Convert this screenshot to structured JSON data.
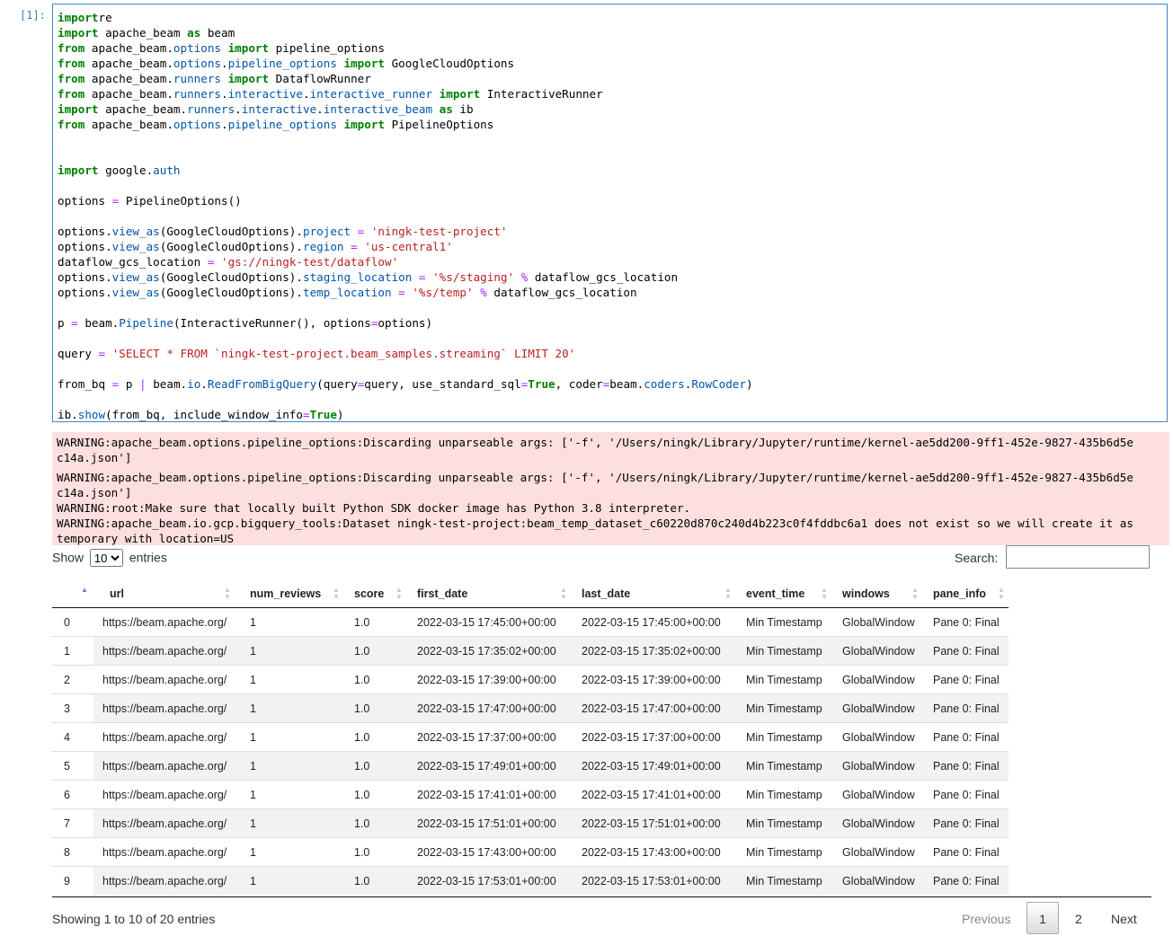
{
  "cell": {
    "prompt": "[1]:",
    "code_lines": [
      [
        [
          "kw",
          "import"
        ],
        [
          "",
          "re"
        ]
      ],
      [
        [
          "kw",
          "import"
        ],
        [
          "",
          " apache_beam "
        ],
        [
          "kw",
          "as"
        ],
        [
          "",
          " beam"
        ]
      ],
      [
        [
          "kw",
          "from"
        ],
        [
          "",
          " apache_beam."
        ],
        [
          "at",
          "options"
        ],
        [
          "",
          " "
        ],
        [
          "kw",
          "import"
        ],
        [
          "",
          " pipeline_options"
        ]
      ],
      [
        [
          "kw",
          "from"
        ],
        [
          "",
          " apache_beam."
        ],
        [
          "at",
          "options"
        ],
        [
          "",
          "."
        ],
        [
          "at",
          "pipeline_options"
        ],
        [
          "",
          " "
        ],
        [
          "kw",
          "import"
        ],
        [
          "",
          " GoogleCloudOptions"
        ]
      ],
      [
        [
          "kw",
          "from"
        ],
        [
          "",
          " apache_beam."
        ],
        [
          "at",
          "runners"
        ],
        [
          "",
          " "
        ],
        [
          "kw",
          "import"
        ],
        [
          "",
          " DataflowRunner"
        ]
      ],
      [
        [
          "kw",
          "from"
        ],
        [
          "",
          " apache_beam."
        ],
        [
          "at",
          "runners"
        ],
        [
          "",
          "."
        ],
        [
          "at",
          "interactive"
        ],
        [
          "",
          "."
        ],
        [
          "at",
          "interactive_runner"
        ],
        [
          "",
          " "
        ],
        [
          "kw",
          "import"
        ],
        [
          "",
          " InteractiveRunner"
        ]
      ],
      [
        [
          "kw",
          "import"
        ],
        [
          "",
          " apache_beam."
        ],
        [
          "at",
          "runners"
        ],
        [
          "",
          "."
        ],
        [
          "at",
          "interactive"
        ],
        [
          "",
          "."
        ],
        [
          "at",
          "interactive_beam"
        ],
        [
          "",
          " "
        ],
        [
          "kw",
          "as"
        ],
        [
          "",
          " ib"
        ]
      ],
      [
        [
          "kw",
          "from"
        ],
        [
          "",
          " apache_beam."
        ],
        [
          "at",
          "options"
        ],
        [
          "",
          "."
        ],
        [
          "at",
          "pipeline_options"
        ],
        [
          "",
          " "
        ],
        [
          "kw",
          "import"
        ],
        [
          "",
          " PipelineOptions"
        ]
      ],
      [],
      [],
      [
        [
          "kw",
          "import"
        ],
        [
          "",
          " google."
        ],
        [
          "at",
          "auth"
        ]
      ],
      [],
      [
        [
          "",
          "options "
        ],
        [
          "op",
          "="
        ],
        [
          "",
          " PipelineOptions()"
        ]
      ],
      [],
      [
        [
          "",
          "options."
        ],
        [
          "at",
          "view_as"
        ],
        [
          "",
          "(GoogleCloudOptions)."
        ],
        [
          "at",
          "project"
        ],
        [
          "",
          " "
        ],
        [
          "op",
          "="
        ],
        [
          "",
          " "
        ],
        [
          "st",
          "'ningk-test-project'"
        ]
      ],
      [
        [
          "",
          "options."
        ],
        [
          "at",
          "view_as"
        ],
        [
          "",
          "(GoogleCloudOptions)."
        ],
        [
          "at",
          "region"
        ],
        [
          "",
          " "
        ],
        [
          "op",
          "="
        ],
        [
          "",
          " "
        ],
        [
          "st",
          "'us-central1'"
        ]
      ],
      [
        [
          "",
          "dataflow_gcs_location "
        ],
        [
          "op",
          "="
        ],
        [
          "",
          " "
        ],
        [
          "st",
          "'gs://ningk-test/dataflow'"
        ]
      ],
      [
        [
          "",
          "options."
        ],
        [
          "at",
          "view_as"
        ],
        [
          "",
          "(GoogleCloudOptions)."
        ],
        [
          "at",
          "staging_location"
        ],
        [
          "",
          " "
        ],
        [
          "op",
          "="
        ],
        [
          "",
          " "
        ],
        [
          "st",
          "'%s/staging'"
        ],
        [
          "",
          " "
        ],
        [
          "op",
          "%"
        ],
        [
          "",
          " dataflow_gcs_location"
        ]
      ],
      [
        [
          "",
          "options."
        ],
        [
          "at",
          "view_as"
        ],
        [
          "",
          "(GoogleCloudOptions)."
        ],
        [
          "at",
          "temp_location"
        ],
        [
          "",
          " "
        ],
        [
          "op",
          "="
        ],
        [
          "",
          " "
        ],
        [
          "st",
          "'%s/temp'"
        ],
        [
          "",
          " "
        ],
        [
          "op",
          "%"
        ],
        [
          "",
          " dataflow_gcs_location"
        ]
      ],
      [],
      [
        [
          "",
          "p "
        ],
        [
          "op",
          "="
        ],
        [
          "",
          " beam."
        ],
        [
          "at",
          "Pipeline"
        ],
        [
          "",
          "(InteractiveRunner(), options"
        ],
        [
          "op",
          "="
        ],
        [
          "",
          "options)"
        ]
      ],
      [],
      [
        [
          "",
          "query "
        ],
        [
          "op",
          "="
        ],
        [
          "",
          " "
        ],
        [
          "st",
          "'SELECT * FROM `ningk-test-project.beam_samples.streaming` LIMIT 20'"
        ]
      ],
      [],
      [
        [
          "",
          "from_bq "
        ],
        [
          "op",
          "="
        ],
        [
          "",
          " p "
        ],
        [
          "op",
          "|"
        ],
        [
          "",
          " beam."
        ],
        [
          "at",
          "io"
        ],
        [
          "",
          "."
        ],
        [
          "at",
          "ReadFromBigQuery"
        ],
        [
          "",
          "(query"
        ],
        [
          "op",
          "="
        ],
        [
          "",
          "query, use_standard_sql"
        ],
        [
          "op",
          "="
        ],
        [
          "kw",
          "True"
        ],
        [
          "",
          ", coder"
        ],
        [
          "op",
          "="
        ],
        [
          "",
          "beam."
        ],
        [
          "at",
          "coders"
        ],
        [
          "",
          "."
        ],
        [
          "at",
          "RowCoder"
        ],
        [
          "",
          ")"
        ]
      ],
      [],
      [
        [
          "",
          "ib."
        ],
        [
          "at",
          "show"
        ],
        [
          "",
          "(from_bq, include_window_info"
        ],
        [
          "op",
          "="
        ],
        [
          "kw",
          "True"
        ],
        [
          "",
          ")"
        ]
      ]
    ]
  },
  "stderr": {
    "lines": [
      "WARNING:apache_beam.options.pipeline_options:Discarding unparseable args: ['-f', '/Users/ningk/Library/Jupyter/runtime/kernel-ae5dd200-9ff1-452e-9827-435b6d5e",
      "c14a.json']",
      "WARNING:apache_beam.options.pipeline_options:Discarding unparseable args: ['-f', '/Users/ningk/Library/Jupyter/runtime/kernel-ae5dd200-9ff1-452e-9827-435b6d5e",
      "c14a.json']",
      "WARNING:root:Make sure that locally built Python SDK docker image has Python 3.8 interpreter.",
      "WARNING:apache_beam.io.gcp.bigquery_tools:Dataset ningk-test-project:beam_temp_dataset_c60220d870c240d4b223c0f4fddbc6a1 does not exist so we will create it as",
      "temporary with location=US"
    ]
  },
  "datatable": {
    "show_label": "Show",
    "entries_label": "entries",
    "page_length": "10",
    "search_label": "Search:",
    "search_value": "",
    "columns": [
      "",
      "url",
      "num_reviews",
      "score",
      "first_date",
      "last_date",
      "event_time",
      "windows",
      "pane_info"
    ],
    "rows": [
      [
        "0",
        "https://beam.apache.org/",
        "1",
        "1.0",
        "2022-03-15 17:45:00+00:00",
        "2022-03-15 17:45:00+00:00",
        "Min Timestamp",
        "GlobalWindow",
        "Pane 0: Final"
      ],
      [
        "1",
        "https://beam.apache.org/",
        "1",
        "1.0",
        "2022-03-15 17:35:02+00:00",
        "2022-03-15 17:35:02+00:00",
        "Min Timestamp",
        "GlobalWindow",
        "Pane 0: Final"
      ],
      [
        "2",
        "https://beam.apache.org/",
        "1",
        "1.0",
        "2022-03-15 17:39:00+00:00",
        "2022-03-15 17:39:00+00:00",
        "Min Timestamp",
        "GlobalWindow",
        "Pane 0: Final"
      ],
      [
        "3",
        "https://beam.apache.org/",
        "1",
        "1.0",
        "2022-03-15 17:47:00+00:00",
        "2022-03-15 17:47:00+00:00",
        "Min Timestamp",
        "GlobalWindow",
        "Pane 0: Final"
      ],
      [
        "4",
        "https://beam.apache.org/",
        "1",
        "1.0",
        "2022-03-15 17:37:00+00:00",
        "2022-03-15 17:37:00+00:00",
        "Min Timestamp",
        "GlobalWindow",
        "Pane 0: Final"
      ],
      [
        "5",
        "https://beam.apache.org/",
        "1",
        "1.0",
        "2022-03-15 17:49:01+00:00",
        "2022-03-15 17:49:01+00:00",
        "Min Timestamp",
        "GlobalWindow",
        "Pane 0: Final"
      ],
      [
        "6",
        "https://beam.apache.org/",
        "1",
        "1.0",
        "2022-03-15 17:41:01+00:00",
        "2022-03-15 17:41:01+00:00",
        "Min Timestamp",
        "GlobalWindow",
        "Pane 0: Final"
      ],
      [
        "7",
        "https://beam.apache.org/",
        "1",
        "1.0",
        "2022-03-15 17:51:01+00:00",
        "2022-03-15 17:51:01+00:00",
        "Min Timestamp",
        "GlobalWindow",
        "Pane 0: Final"
      ],
      [
        "8",
        "https://beam.apache.org/",
        "1",
        "1.0",
        "2022-03-15 17:43:00+00:00",
        "2022-03-15 17:43:00+00:00",
        "Min Timestamp",
        "GlobalWindow",
        "Pane 0: Final"
      ],
      [
        "9",
        "https://beam.apache.org/",
        "1",
        "1.0",
        "2022-03-15 17:53:01+00:00",
        "2022-03-15 17:53:01+00:00",
        "Min Timestamp",
        "GlobalWindow",
        "Pane 0: Final"
      ]
    ],
    "info": "Showing 1 to 10 of 20 entries",
    "pagination": {
      "previous": "Previous",
      "page1": "1",
      "page2": "2",
      "next": "Next"
    }
  }
}
